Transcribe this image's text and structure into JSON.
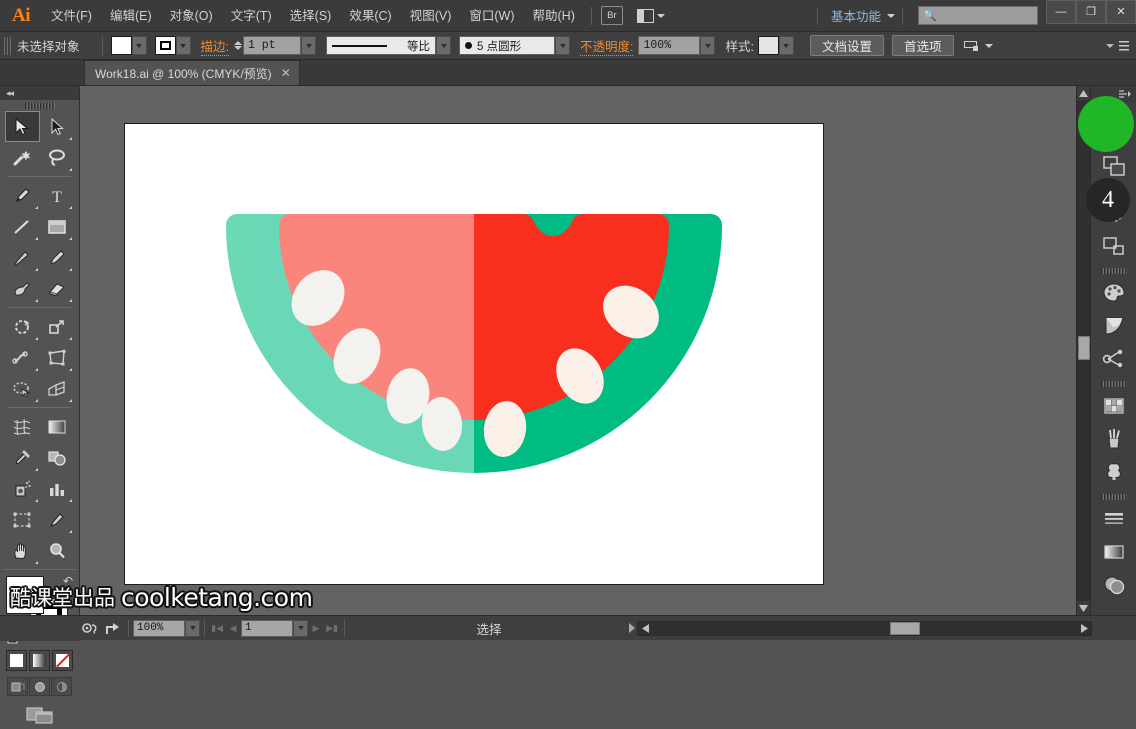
{
  "app": {
    "logo": "Ai",
    "menus": [
      {
        "label": "文件(F)",
        "name": "menu-file"
      },
      {
        "label": "编辑(E)",
        "name": "menu-edit"
      },
      {
        "label": "对象(O)",
        "name": "menu-object"
      },
      {
        "label": "文字(T)",
        "name": "menu-type"
      },
      {
        "label": "选择(S)",
        "name": "menu-select"
      },
      {
        "label": "效果(C)",
        "name": "menu-effect"
      },
      {
        "label": "视图(V)",
        "name": "menu-view"
      },
      {
        "label": "窗口(W)",
        "name": "menu-window"
      },
      {
        "label": "帮助(H)",
        "name": "menu-help"
      }
    ],
    "bridge_label": "Br",
    "workspace": "基本功能",
    "search_placeholder": "",
    "search_value": "",
    "window_buttons": {
      "minimize": "—",
      "maximize": "❐",
      "close": "✕"
    }
  },
  "control_bar": {
    "selection_status": "未选择对象",
    "fill_color": "#ffffff",
    "stroke_label": "描边:",
    "stroke_weight": "1 pt",
    "profile_label": "等比",
    "brush_label": "5 点圆形",
    "opacity_label": "不透明度:",
    "opacity_value": "100%",
    "style_label": "样式:",
    "document_setup": "文档设置",
    "preferences": "首选项"
  },
  "tab": {
    "title": "Work18.ai @ 100% (CMYK/预览)",
    "close": "✕"
  },
  "toolbar": {
    "tools": [
      {
        "name": "selection-tool",
        "title": "选择工具",
        "active": true
      },
      {
        "name": "direct-selection-tool",
        "title": "直接选择工具",
        "active": false
      },
      {
        "name": "magic-wand-tool",
        "title": "魔棒工具",
        "active": false
      },
      {
        "name": "lasso-tool",
        "title": "套索工具",
        "active": false
      },
      {
        "name": "pen-tool",
        "title": "钢笔工具",
        "active": false
      },
      {
        "name": "type-tool",
        "title": "文字工具",
        "active": false
      },
      {
        "name": "line-segment-tool",
        "title": "直线段工具",
        "active": false
      },
      {
        "name": "rectangle-tool",
        "title": "矩形工具",
        "active": false
      },
      {
        "name": "paintbrush-tool",
        "title": "画笔工具",
        "active": false
      },
      {
        "name": "pencil-tool",
        "title": "铅笔工具",
        "active": false
      },
      {
        "name": "blob-brush-tool",
        "title": "斑点画笔工具",
        "active": false
      },
      {
        "name": "eraser-tool",
        "title": "橡皮擦工具",
        "active": false
      },
      {
        "name": "rotate-tool",
        "title": "旋转工具",
        "active": false
      },
      {
        "name": "scale-tool",
        "title": "比例缩放工具",
        "active": false
      },
      {
        "name": "width-tool",
        "title": "宽度工具",
        "active": false
      },
      {
        "name": "free-transform-tool",
        "title": "自由变换工具",
        "active": false
      },
      {
        "name": "shape-builder-tool",
        "title": "形状生成器工具",
        "active": false
      },
      {
        "name": "perspective-grid-tool",
        "title": "透视网格工具",
        "active": false
      },
      {
        "name": "mesh-tool",
        "title": "网格工具",
        "active": false
      },
      {
        "name": "gradient-tool",
        "title": "渐变工具",
        "active": false
      },
      {
        "name": "eyedropper-tool",
        "title": "吸管工具",
        "active": false
      },
      {
        "name": "blend-tool",
        "title": "混合工具",
        "active": false
      },
      {
        "name": "symbol-sprayer-tool",
        "title": "符号喷枪工具",
        "active": false
      },
      {
        "name": "column-graph-tool",
        "title": "柱形图工具",
        "active": false
      },
      {
        "name": "artboard-tool",
        "title": "画板工具",
        "active": false
      },
      {
        "name": "slice-tool",
        "title": "切片工具",
        "active": false
      },
      {
        "name": "hand-tool",
        "title": "抓手工具",
        "active": false
      },
      {
        "name": "zoom-tool",
        "title": "缩放工具",
        "active": false
      }
    ],
    "fill_color": "#ffffff",
    "stroke_color": "#000000"
  },
  "right_dock": {
    "panels": [
      {
        "name": "layers-panel-icon",
        "glyph": "layers"
      },
      {
        "name": "transparency-panel-icon",
        "glyph": "circle-dashed"
      },
      {
        "name": "align-panel-icon",
        "glyph": "squares"
      },
      {
        "name": "color-panel-icon",
        "glyph": "palette"
      },
      {
        "name": "color-guide-panel-icon",
        "glyph": "fan"
      },
      {
        "name": "symbols-panel-icon",
        "glyph": "nodes"
      },
      {
        "name": "swatches-panel-icon",
        "glyph": "grid"
      },
      {
        "name": "brushes-panel-icon",
        "glyph": "brushes"
      },
      {
        "name": "graphic-styles-panel-icon",
        "glyph": "club"
      },
      {
        "name": "stroke-panel-icon",
        "glyph": "lines"
      },
      {
        "name": "gradient-panel-icon",
        "glyph": "gradient"
      },
      {
        "name": "appearance-panel-icon",
        "glyph": "appearance"
      }
    ],
    "badge_number": "4",
    "badge_color": "#262626",
    "highlight_color": "#1fb726"
  },
  "status_bar": {
    "zoom_level": "100%",
    "page_number": "1",
    "status_text": "选择"
  },
  "watermark": {
    "chinese": "酷课堂出品",
    "english": "coolketang.com"
  },
  "artwork": {
    "title": "watermelon-slice",
    "colors": {
      "rind_light": "#7dcca8",
      "rind_dark": "#00bc82",
      "flesh_light": "#fa8450",
      "flesh_dark": "#f82e1e",
      "seed_light": "#e4e1da",
      "seed_dark": "#faf0e8",
      "background": "#ffffff"
    },
    "seeds": 7,
    "bite_notch": true
  }
}
